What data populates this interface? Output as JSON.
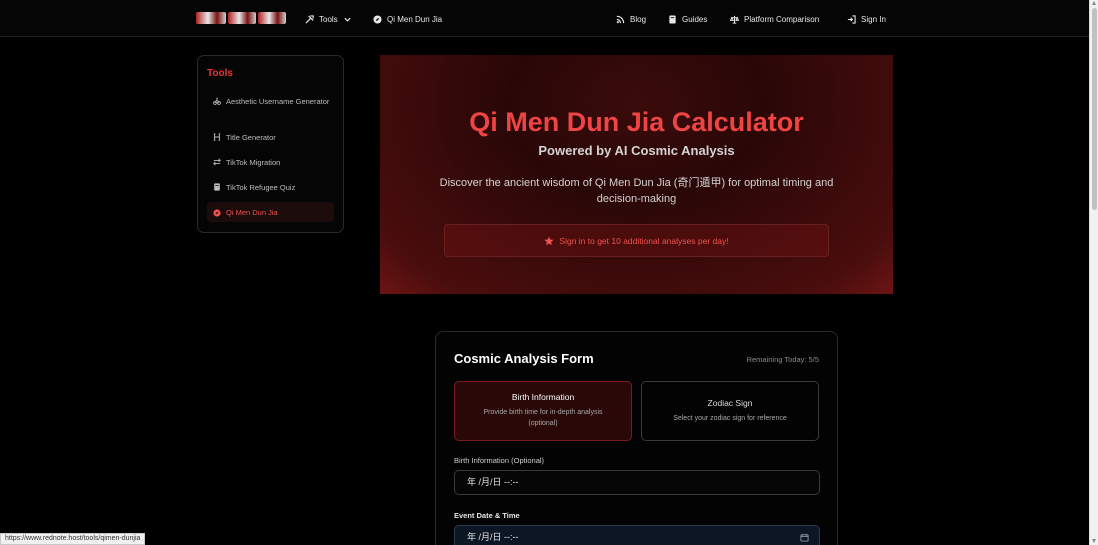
{
  "nav": {
    "tools_label": "Tools",
    "qimen_label": "Qi Men Dun Jia",
    "blog_label": "Blog",
    "guides_label": "Guides",
    "platform_label": "Platform Comparison",
    "signin_label": "Sign In"
  },
  "sidebar": {
    "title": "Tools",
    "items": [
      {
        "label": "Aesthetic Username Generator",
        "icon": "rickshaw-icon"
      },
      {
        "label": "Title Generator",
        "icon": "heading-icon"
      },
      {
        "label": "TikTok Migration",
        "icon": "exchange-icon"
      },
      {
        "label": "TikTok Refugee Quiz",
        "icon": "book-icon"
      },
      {
        "label": "Qi Men Dun Jia",
        "icon": "compass-icon"
      }
    ]
  },
  "hero": {
    "title": "Qi Men Dun Jia Calculator",
    "subtitle": "Powered by AI Cosmic Analysis",
    "description": "Discover the ancient wisdom of Qi Men Dun Jia (奇门遁甲) for optimal timing and decision-making",
    "cta": "Sign in to get 10 additional analyses per day!"
  },
  "form": {
    "title": "Cosmic Analysis Form",
    "remaining": "Remaining Today: 5/5",
    "option_birth_title": "Birth Information",
    "option_birth_desc": "Provide birth time for in-depth analysis (optional)",
    "option_zodiac_title": "Zodiac Sign",
    "option_zodiac_desc": "Select your zodiac sign for reference",
    "birth_label": "Birth Information (Optional)",
    "birth_value": "年 /月/日 --:--",
    "event_label": "Event Date & Time",
    "event_value": "年 /月/日 --:--"
  },
  "status_url": "https://www.rednote.host/tools/qimen-dunjia",
  "colors": {
    "accent": "#ef4444",
    "background": "#000000",
    "hero_bg": "#3a0b0b"
  }
}
